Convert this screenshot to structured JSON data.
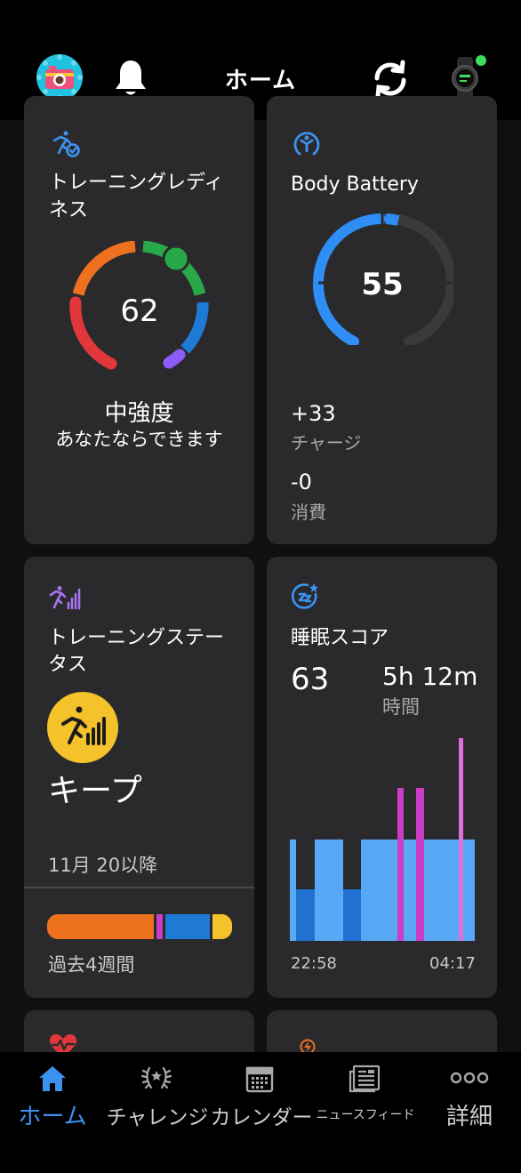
{
  "header": {
    "title": "ホーム",
    "avatar_icon": "camera-avatar-icon",
    "notifications_icon": "bell-icon",
    "sync_icon": "sync-icon",
    "device_icon": "watch-icon",
    "device_status_color": "#3ddc5a"
  },
  "cards": {
    "training_readiness": {
      "icon": "runner-check-icon",
      "title_line1": "トレーニングレディ",
      "title_line2": "ネス",
      "score": "62",
      "score_fraction": 0.62,
      "level": "中強度",
      "message": "あなたならできます"
    },
    "body_battery": {
      "icon": "body-battery-icon",
      "title": "Body Battery",
      "value": "55",
      "value_fraction": 0.55,
      "charge_value": "+33",
      "charge_label": "チャージ",
      "drain_value": "-0",
      "drain_label": "消費"
    },
    "training_status": {
      "icon": "runner-bars-icon",
      "title_line1": "トレーニングステー",
      "title_line2": "タス",
      "status": "キープ",
      "since": "11月 20以降",
      "period": "過去4週間"
    },
    "sleep_score": {
      "icon": "sleep-zz-icon",
      "title": "睡眠スコア",
      "score": "63",
      "duration": "5h 12m",
      "duration_label": "時間",
      "start_time": "22:58",
      "end_time": "04:17"
    },
    "heart_rate": {
      "icon": "heart-rate-icon"
    },
    "stress": {
      "icon": "stress-icon"
    }
  },
  "bottom_nav": {
    "items": [
      {
        "label": "ホーム",
        "icon": "home-icon",
        "active": true
      },
      {
        "label": "チャレンジ",
        "icon": "laurel-icon",
        "active": false
      },
      {
        "label": "カレンダー",
        "icon": "calendar-icon",
        "active": false
      },
      {
        "label": "ニュースフィード",
        "icon": "newsfeed-icon",
        "active": false
      },
      {
        "label": "詳細",
        "icon": "more-icon",
        "active": false
      }
    ]
  },
  "colors": {
    "accent_blue": "#2f8ef5",
    "readiness_red": "#e2373a",
    "readiness_orange": "#ee7120",
    "readiness_green": "#29a84a",
    "readiness_blue": "#1f7ad6",
    "readiness_purple": "#8c5cf6",
    "status_yellow": "#f4c22b",
    "sleep_light": "#59a8f6",
    "sleep_deep": "#1f72d0",
    "sleep_rem": "#cc3dc7"
  }
}
